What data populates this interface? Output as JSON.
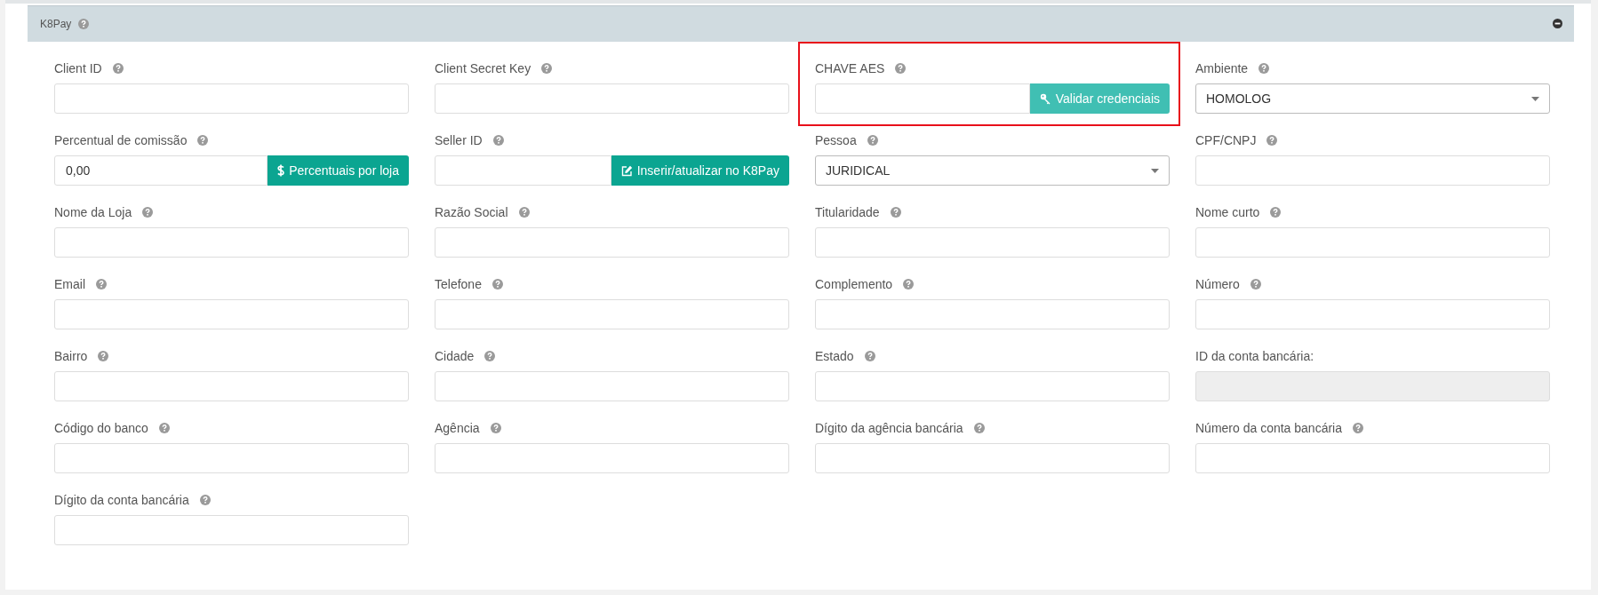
{
  "panel": {
    "title": "K8Pay",
    "help": true,
    "expanded": true
  },
  "fields": [
    {
      "label": "Client ID",
      "help": true,
      "kind": "text"
    },
    {
      "label": "Client Secret Key",
      "help": true,
      "kind": "text"
    },
    {
      "label": "CHAVE AES",
      "help": true,
      "kind": "text",
      "highlighted": true,
      "button": {
        "label": "Validar credenciais",
        "color": "#40bfb3"
      }
    },
    {
      "label": "Ambiente",
      "help": true,
      "kind": "select",
      "value": "HOMOLOG"
    },
    {
      "label": "Percentual de comissão",
      "help": true,
      "kind": "text",
      "value": "0,00",
      "button": {
        "label": "Percentuais por loja",
        "color": "#0ba591"
      }
    },
    {
      "label": "Seller ID",
      "help": true,
      "kind": "text",
      "button": {
        "label": "Inserir/atualizar no K8Pay",
        "color": "#0ba591"
      }
    },
    {
      "label": "Pessoa",
      "help": true,
      "kind": "select",
      "value": "JURIDICAL"
    },
    {
      "label": "CPF/CNPJ",
      "help": true,
      "kind": "text"
    },
    {
      "label": "Nome da Loja",
      "help": true,
      "kind": "text"
    },
    {
      "label": "Razão Social",
      "help": true,
      "kind": "text"
    },
    {
      "label": "Titularidade",
      "help": true,
      "kind": "text"
    },
    {
      "label": "Nome curto",
      "help": true,
      "kind": "text"
    },
    {
      "label": "Email",
      "help": true,
      "kind": "text"
    },
    {
      "label": "Telefone",
      "help": true,
      "kind": "text"
    },
    {
      "label": "Complemento",
      "help": true,
      "kind": "text"
    },
    {
      "label": "Número",
      "help": true,
      "kind": "text"
    },
    {
      "label": "Bairro",
      "help": true,
      "kind": "text"
    },
    {
      "label": "Cidade",
      "help": true,
      "kind": "text"
    },
    {
      "label": "Estado",
      "help": true,
      "kind": "text"
    },
    {
      "label": "ID da conta bancária:",
      "help": false,
      "kind": "disabled"
    },
    {
      "label": "Código do banco",
      "help": true,
      "kind": "text"
    },
    {
      "label": "Agência",
      "help": true,
      "kind": "text"
    },
    {
      "label": "Dígito da agência bancária",
      "help": true,
      "kind": "text"
    },
    {
      "label": "Número da conta bancária",
      "help": true,
      "kind": "text"
    },
    {
      "label": "Dígito da conta bancária",
      "help": true,
      "kind": "text"
    }
  ]
}
